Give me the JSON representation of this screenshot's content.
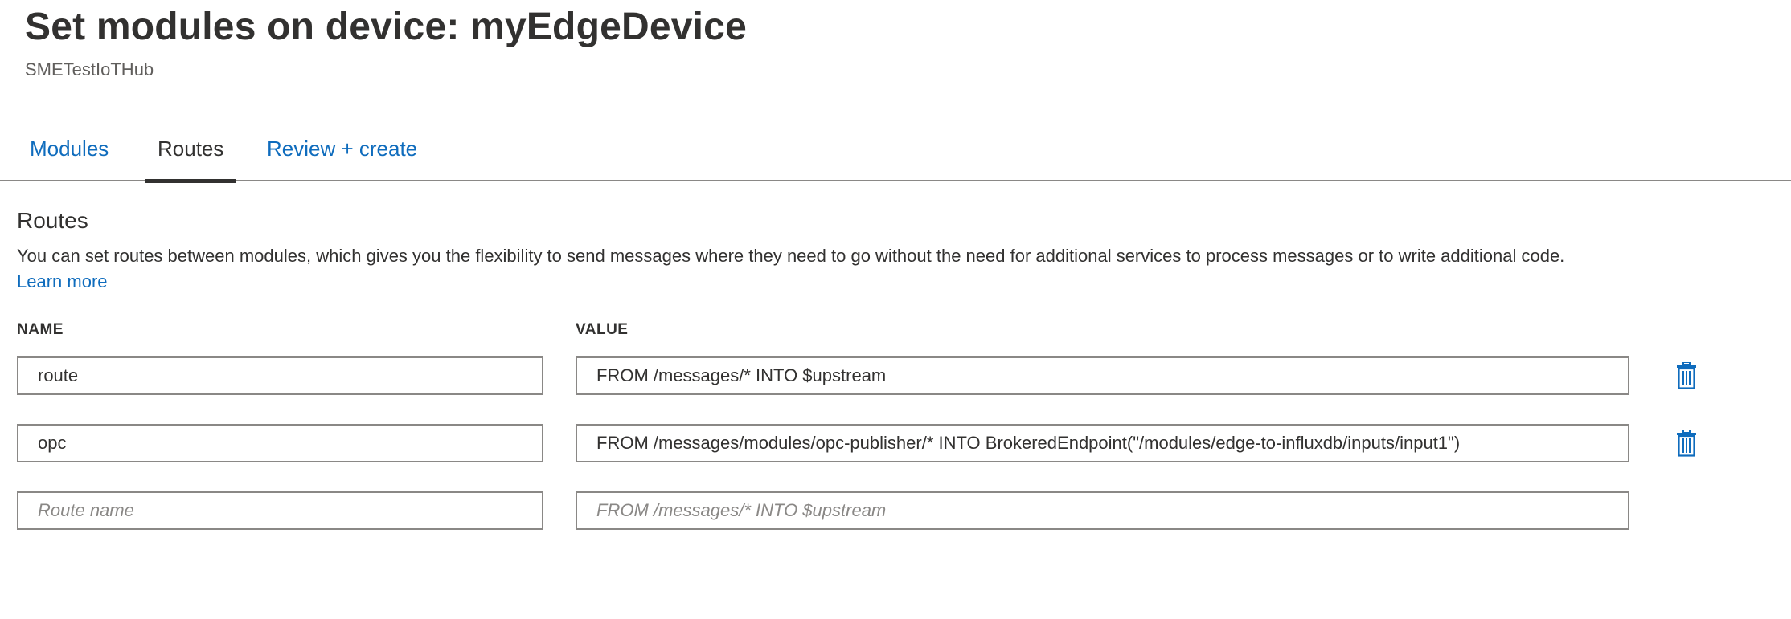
{
  "header": {
    "title": "Set modules on device: myEdgeDevice",
    "subtitle": "SMETestIoTHub"
  },
  "tabs": [
    {
      "label": "Modules",
      "active": false
    },
    {
      "label": "Routes",
      "active": true
    },
    {
      "label": "Review + create",
      "active": false
    }
  ],
  "routes_section": {
    "title": "Routes",
    "description": "You can set routes between modules, which gives you the flexibility to send messages where they need to go without the need for additional services to process messages or to write additional code.",
    "learn_more": "Learn more",
    "columns": {
      "name": "NAME",
      "value": "VALUE"
    },
    "rows": [
      {
        "name": "route",
        "value": "FROM /messages/* INTO $upstream"
      },
      {
        "name": "opc",
        "value": "FROM /messages/modules/opc-publisher/* INTO BrokeredEndpoint(\"/modules/edge-to-influxdb/inputs/input1\")"
      }
    ],
    "new_row": {
      "name_placeholder": "Route name",
      "value_placeholder": "FROM /messages/* INTO $upstream"
    }
  },
  "colors": {
    "link": "#0f6cbd",
    "text": "#323130",
    "border": "#8a8886",
    "muted": "#605e5c"
  },
  "icons": {
    "delete": "trash-icon"
  }
}
